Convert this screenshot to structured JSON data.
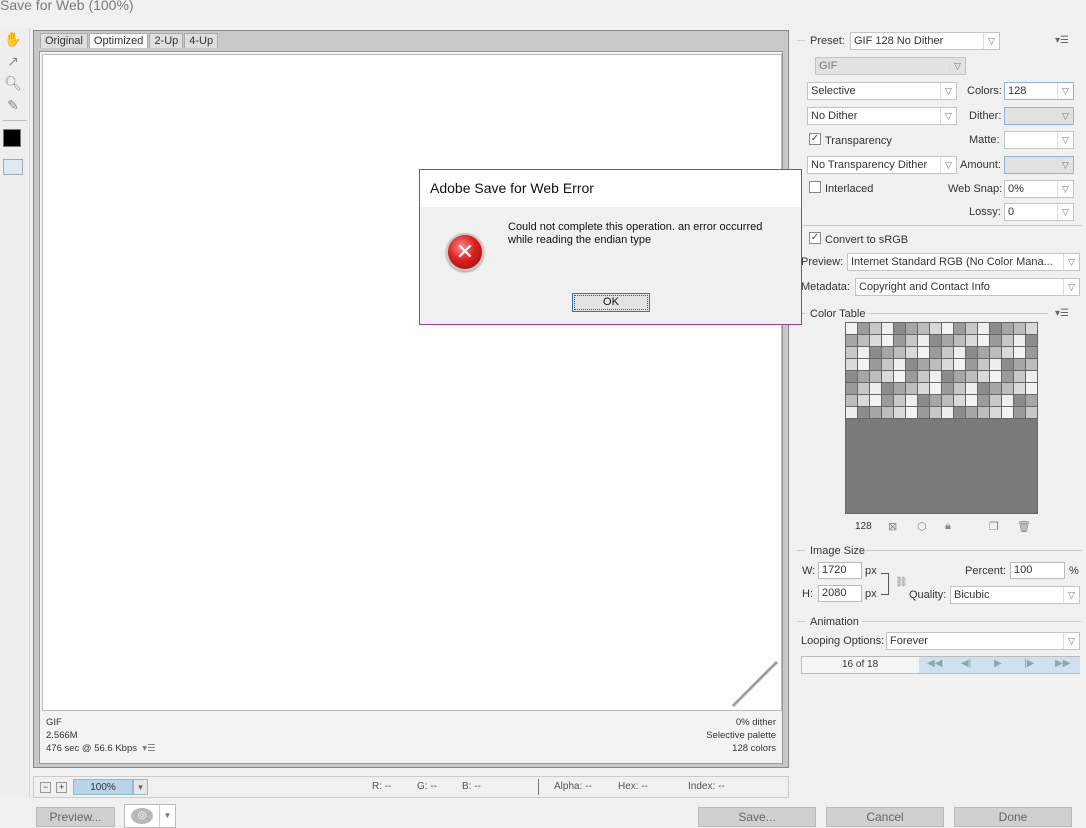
{
  "window": {
    "title": "Save for Web (100%)"
  },
  "tabs": [
    "Original",
    "Optimized",
    "2-Up",
    "4-Up"
  ],
  "tools": {
    "hand": "hand-tool-icon",
    "slice": "slice-select-icon",
    "zoom": "zoom-icon",
    "eyedropper": "eyedropper-icon"
  },
  "preview_info": {
    "format": "GIF",
    "size": "2.566M",
    "speed": "476 sec @ 56.6 Kbps",
    "speed_menu": "▾☰",
    "dither": "0% dither",
    "palette": "Selective palette",
    "colors": "128 colors"
  },
  "statusbar": {
    "zoom": "100%",
    "minus": "−",
    "plus": "+",
    "r": "R: --",
    "g": "G: --",
    "b": "B: --",
    "alpha": "Alpha: --",
    "hex": "Hex: --",
    "index": "Index: --"
  },
  "buttons": {
    "preview": "Preview...",
    "save": "Save...",
    "cancel": "Cancel",
    "done": "Done"
  },
  "settings": {
    "preset_label": "Preset:",
    "preset_value": "GIF 128 No Dither",
    "format": "GIF",
    "reduction": "Selective",
    "colors_label": "Colors:",
    "colors_value": "128",
    "dither_algo": "No Dither",
    "dither_label": "Dither:",
    "dither_value": "",
    "transparency_label": "Transparency",
    "matte_label": "Matte:",
    "trans_dither": "No Transparency Dither",
    "amount_label": "Amount:",
    "interlaced_label": "Interlaced",
    "websnap_label": "Web Snap:",
    "websnap_value": "0%",
    "lossy_label": "Lossy:",
    "lossy_value": "0",
    "convert_label": "Convert to sRGB",
    "preview_label": "Preview:",
    "preview_value": "Internet Standard RGB (No Color Mana...",
    "metadata_label": "Metadata:",
    "metadata_value": "Copyright and Contact Info"
  },
  "color_table": {
    "label": "Color Table",
    "count": "128"
  },
  "image_size": {
    "label": "Image Size",
    "w_label": "W:",
    "w_value": "1720",
    "h_label": "H:",
    "h_value": "2080",
    "unit": "px",
    "percent_label": "Percent:",
    "percent_value": "100",
    "percent_unit": "%",
    "quality_label": "Quality:",
    "quality_value": "Bicubic"
  },
  "animation": {
    "label": "Animation",
    "looping_label": "Looping Options:",
    "looping_value": "Forever",
    "frame": "16 of 18"
  },
  "dialog": {
    "title": "Adobe Save for Web Error",
    "message": "Could not complete this operation. an error occurred while reading the endian type",
    "ok": "OK"
  },
  "colors": {
    "dialog_border": "#9a3fa0",
    "zoom_highlight": "#b9d3ec",
    "error_red": "#d92020"
  }
}
